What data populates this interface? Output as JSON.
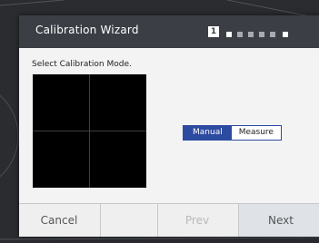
{
  "dialog": {
    "title": "Calibration Wizard",
    "step_indicator": {
      "current": "1",
      "total_steps": 6
    },
    "prompt": "Select Calibration Mode.",
    "mode_toggle": {
      "options": [
        "Manual",
        "Measure"
      ],
      "selected": "Manual"
    },
    "footer": {
      "cancel_label": "Cancel",
      "prev_label": "Prev",
      "next_label": "Next"
    }
  },
  "colors": {
    "titlebar": "#3b3f45",
    "accent": "#2c4aa0",
    "dialog_bg": "#f3f3f3",
    "preview_bg": "#000000"
  }
}
